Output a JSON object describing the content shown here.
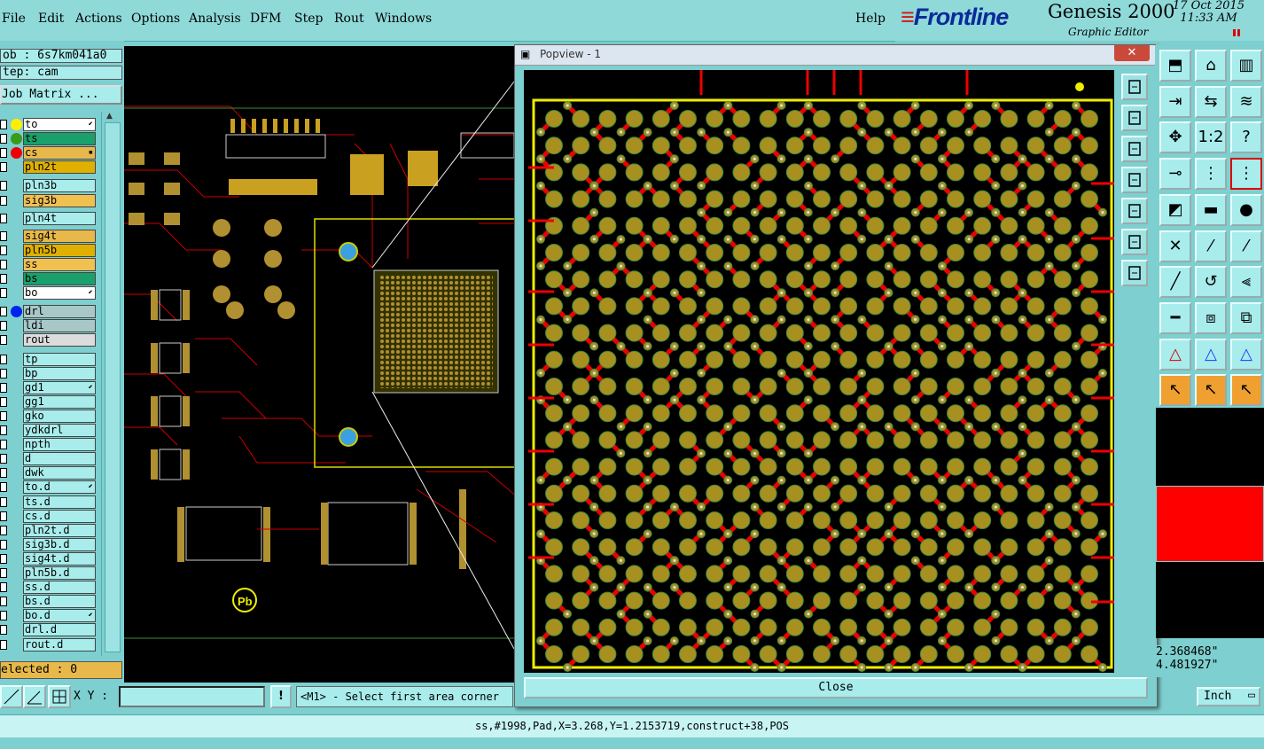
{
  "menu": {
    "items": [
      "File",
      "Edit",
      "Actions",
      "Options",
      "Analysis",
      "DFM",
      "Step",
      "Rout",
      "Windows"
    ],
    "help": "Help"
  },
  "brand": {
    "logo": "Frontline",
    "product": "Genesis 2000",
    "subtitle": "Graphic Editor",
    "date": "17 Oct 2015",
    "time": "11:33 AM"
  },
  "job": {
    "job_line": "ob : 6s7km041a0",
    "step_line": "tep: cam",
    "matrix_button": "Job Matrix ...",
    "selected": "elected : 0"
  },
  "layers": [
    {
      "name": "to",
      "bg": "#ffffff",
      "dot": "#ffee00",
      "mark": "⬋"
    },
    {
      "name": "ts",
      "bg": "#1aa06a",
      "dot": "#3a9a1a",
      "mark": ""
    },
    {
      "name": "cs",
      "bg": "#e8b84a",
      "dot": "#ee0000",
      "mark": "▪"
    },
    {
      "name": "pln2t",
      "bg": "#e0b000",
      "dot": "",
      "mark": ""
    },
    {
      "name": "pln3b",
      "bg": "#a8ecec",
      "dot": "",
      "mark": ""
    },
    {
      "name": "sig3b",
      "bg": "#f0c050",
      "dot": "",
      "mark": ""
    },
    {
      "name": "pln4t",
      "bg": "#a8ecec",
      "dot": "",
      "mark": ""
    },
    {
      "name": "sig4t",
      "bg": "#e8b84a",
      "dot": "",
      "mark": ""
    },
    {
      "name": "pln5b",
      "bg": "#e0b000",
      "dot": "",
      "mark": ""
    },
    {
      "name": "ss",
      "bg": "#f0c050",
      "dot": "",
      "mark": ""
    },
    {
      "name": "bs",
      "bg": "#1aa06a",
      "dot": "",
      "mark": ""
    },
    {
      "name": "bo",
      "bg": "#ffffff",
      "dot": "",
      "mark": "⬋"
    },
    {
      "name": "drl",
      "bg": "#a8c8c8",
      "dot": "#0022ee",
      "mark": ""
    },
    {
      "name": "ldi",
      "bg": "#a8c8c8",
      "dot": "",
      "mark": ""
    },
    {
      "name": "rout",
      "bg": "#dcdcdc",
      "dot": "",
      "mark": ""
    },
    {
      "name": "tp",
      "bg": "#a8ecec",
      "dot": "",
      "mark": ""
    },
    {
      "name": "bp",
      "bg": "#a8ecec",
      "dot": "",
      "mark": ""
    },
    {
      "name": "gd1",
      "bg": "#a8ecec",
      "dot": "",
      "mark": "⬋"
    },
    {
      "name": "gg1",
      "bg": "#a8ecec",
      "dot": "",
      "mark": ""
    },
    {
      "name": "gko",
      "bg": "#a8ecec",
      "dot": "",
      "mark": ""
    },
    {
      "name": "ydkdrl",
      "bg": "#a8ecec",
      "dot": "",
      "mark": ""
    },
    {
      "name": "npth",
      "bg": "#a8ecec",
      "dot": "",
      "mark": ""
    },
    {
      "name": "d",
      "bg": "#a8ecec",
      "dot": "",
      "mark": ""
    },
    {
      "name": "dwk",
      "bg": "#a8ecec",
      "dot": "",
      "mark": ""
    },
    {
      "name": "to.d",
      "bg": "#a8ecec",
      "dot": "",
      "mark": "⬋"
    },
    {
      "name": "ts.d",
      "bg": "#a8ecec",
      "dot": "",
      "mark": ""
    },
    {
      "name": "cs.d",
      "bg": "#a8ecec",
      "dot": "",
      "mark": ""
    },
    {
      "name": "pln2t.d",
      "bg": "#a8ecec",
      "dot": "",
      "mark": ""
    },
    {
      "name": "sig3b.d",
      "bg": "#a8ecec",
      "dot": "",
      "mark": ""
    },
    {
      "name": "sig4t.d",
      "bg": "#a8ecec",
      "dot": "",
      "mark": ""
    },
    {
      "name": "pln5b.d",
      "bg": "#a8ecec",
      "dot": "",
      "mark": ""
    },
    {
      "name": "ss.d",
      "bg": "#a8ecec",
      "dot": "",
      "mark": ""
    },
    {
      "name": "bs.d",
      "bg": "#a8ecec",
      "dot": "",
      "mark": ""
    },
    {
      "name": "bo.d",
      "bg": "#a8ecec",
      "dot": "",
      "mark": "⬋"
    },
    {
      "name": "drl.d",
      "bg": "#a8ecec",
      "dot": "",
      "mark": ""
    },
    {
      "name": "rout.d",
      "bg": "#a8ecec",
      "dot": "",
      "mark": ""
    }
  ],
  "canvas": {
    "silkscreen_label": "Pb"
  },
  "popview": {
    "title": "Popview - 1",
    "close_x": "✕",
    "close_button": "Close",
    "tool_icons": [
      "zoom-home-icon",
      "zoom-in-icon",
      "zoom-out-icon",
      "pan-left-icon",
      "pan-right-icon",
      "fit-screen-icon",
      "zoom-fit-icon"
    ]
  },
  "right_tools": {
    "icons": [
      "open-job-icon",
      "home-icon",
      "window-icon",
      "export-icon",
      "flip-icon",
      "snap-icon",
      "move-icon",
      "scale-1-2-icon",
      "help-icon",
      "route-icon",
      "layer-stack-icon",
      "layer-stack-active-icon",
      "measure-icon",
      "ruler-icon",
      "pad-icon",
      "cross-icon",
      "line-red-icon",
      "line-blue-icon",
      "diagonal-icon",
      "rotate-icon",
      "mirror-icon",
      "minus-icon",
      "zoom-box-icon",
      "circles-icon",
      "triangle-red-icon",
      "triangle-blue-icon",
      "triangle-grid-icon",
      "pointer-icon",
      "pointer-select-icon",
      "pointer-move-icon"
    ],
    "colors": {
      "accent_red": "#ff0000",
      "accent_blue": "#1a3cff",
      "panel": "#7ecfcf"
    }
  },
  "coords": {
    "x": "2.368468\"",
    "y": "4.481927\"",
    "units": "Inch"
  },
  "bottom": {
    "xy_label": "X Y :",
    "xy_value": "",
    "prompt": "<M1> - Select first area corner",
    "bang": "!"
  },
  "status": "ss,#1998,Pad,X=3.268,Y=1.2153719,construct+38,POS"
}
